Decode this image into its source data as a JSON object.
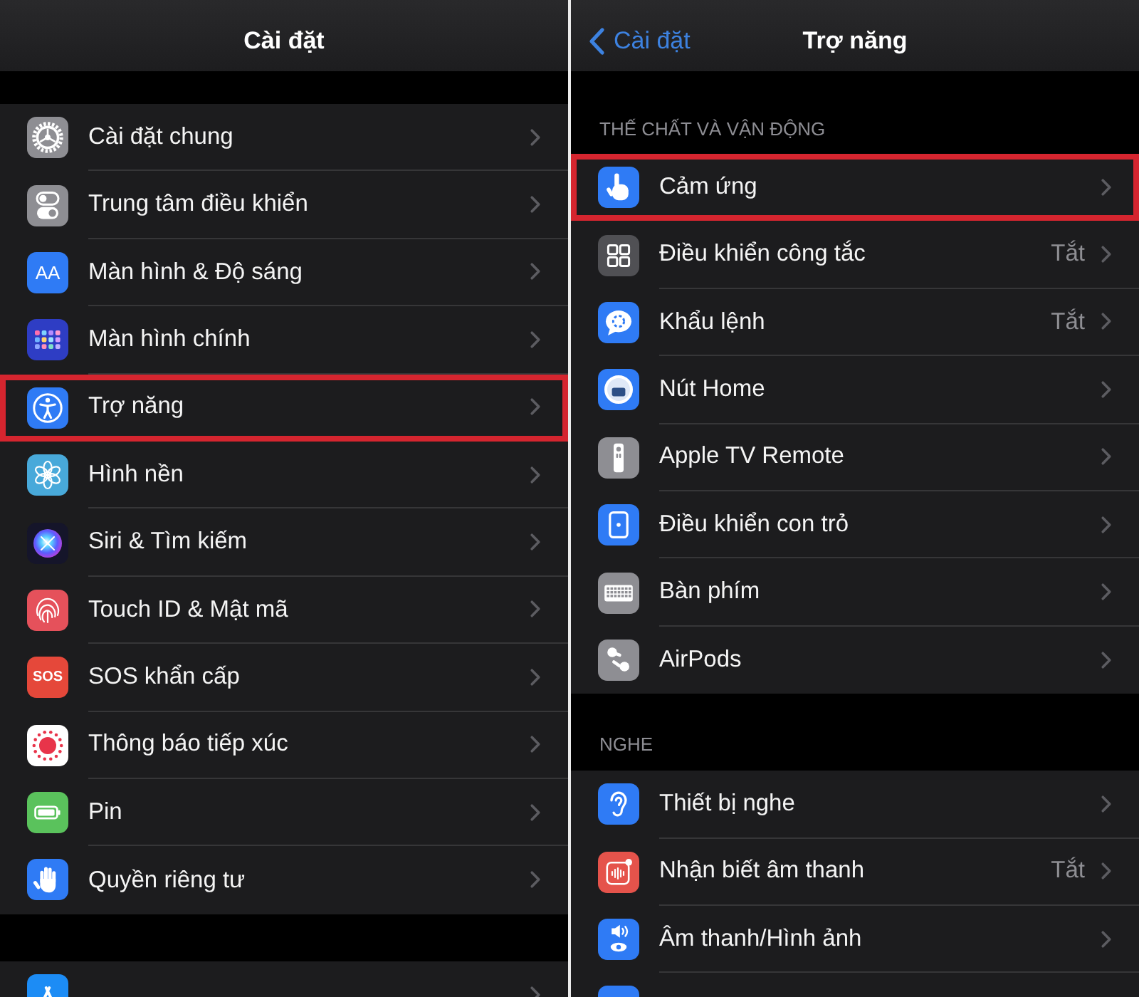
{
  "left": {
    "title": "Cài đặt",
    "sections": [
      {
        "items": [
          {
            "label": "Cài đặt chung",
            "highlighted": false
          },
          {
            "label": "Trung tâm điều khiển",
            "highlighted": false
          },
          {
            "label": "Màn hình & Độ sáng",
            "icon_text": "AA",
            "highlighted": false
          },
          {
            "label": "Màn hình chính",
            "highlighted": false
          },
          {
            "label": "Trợ năng",
            "highlighted": true
          },
          {
            "label": "Hình nền",
            "highlighted": false
          },
          {
            "label": "Siri & Tìm kiếm",
            "highlighted": false
          },
          {
            "label": "Touch ID & Mật mã",
            "highlighted": false
          },
          {
            "label": "SOS khẩn cấp",
            "icon_text": "SOS",
            "highlighted": false
          },
          {
            "label": "Thông báo tiếp xúc",
            "highlighted": false
          },
          {
            "label": "Pin",
            "highlighted": false
          },
          {
            "label": "Quyền riêng tư",
            "highlighted": false
          }
        ]
      },
      {
        "items": [
          {
            "highlighted": false
          }
        ]
      }
    ]
  },
  "right": {
    "back_button": "Cài đặt",
    "title": "Trợ năng",
    "sections": [
      {
        "header": "THẾ CHẤT VÀ VẬN ĐỘNG",
        "items": [
          {
            "label": "Cảm ứng",
            "highlighted": true
          },
          {
            "label": "Điều khiển công tắc",
            "value": "Tắt",
            "highlighted": false
          },
          {
            "label": "Khẩu lệnh",
            "value": "Tắt",
            "highlighted": false
          },
          {
            "label": "Nút Home",
            "highlighted": false
          },
          {
            "label": "Apple TV Remote",
            "highlighted": false
          },
          {
            "label": "Điều khiển con trỏ",
            "highlighted": false
          },
          {
            "label": "Bàn phím",
            "highlighted": false
          },
          {
            "label": "AirPods",
            "highlighted": false
          }
        ]
      },
      {
        "header": "NGHE",
        "items": [
          {
            "label": "Thiết bị nghe",
            "highlighted": false
          },
          {
            "label": "Nhận biết âm thanh",
            "value": "Tắt",
            "highlighted": false
          },
          {
            "label": "Âm thanh/Hình ảnh",
            "highlighted": false
          },
          {
            "highlighted": false
          }
        ]
      }
    ]
  }
}
